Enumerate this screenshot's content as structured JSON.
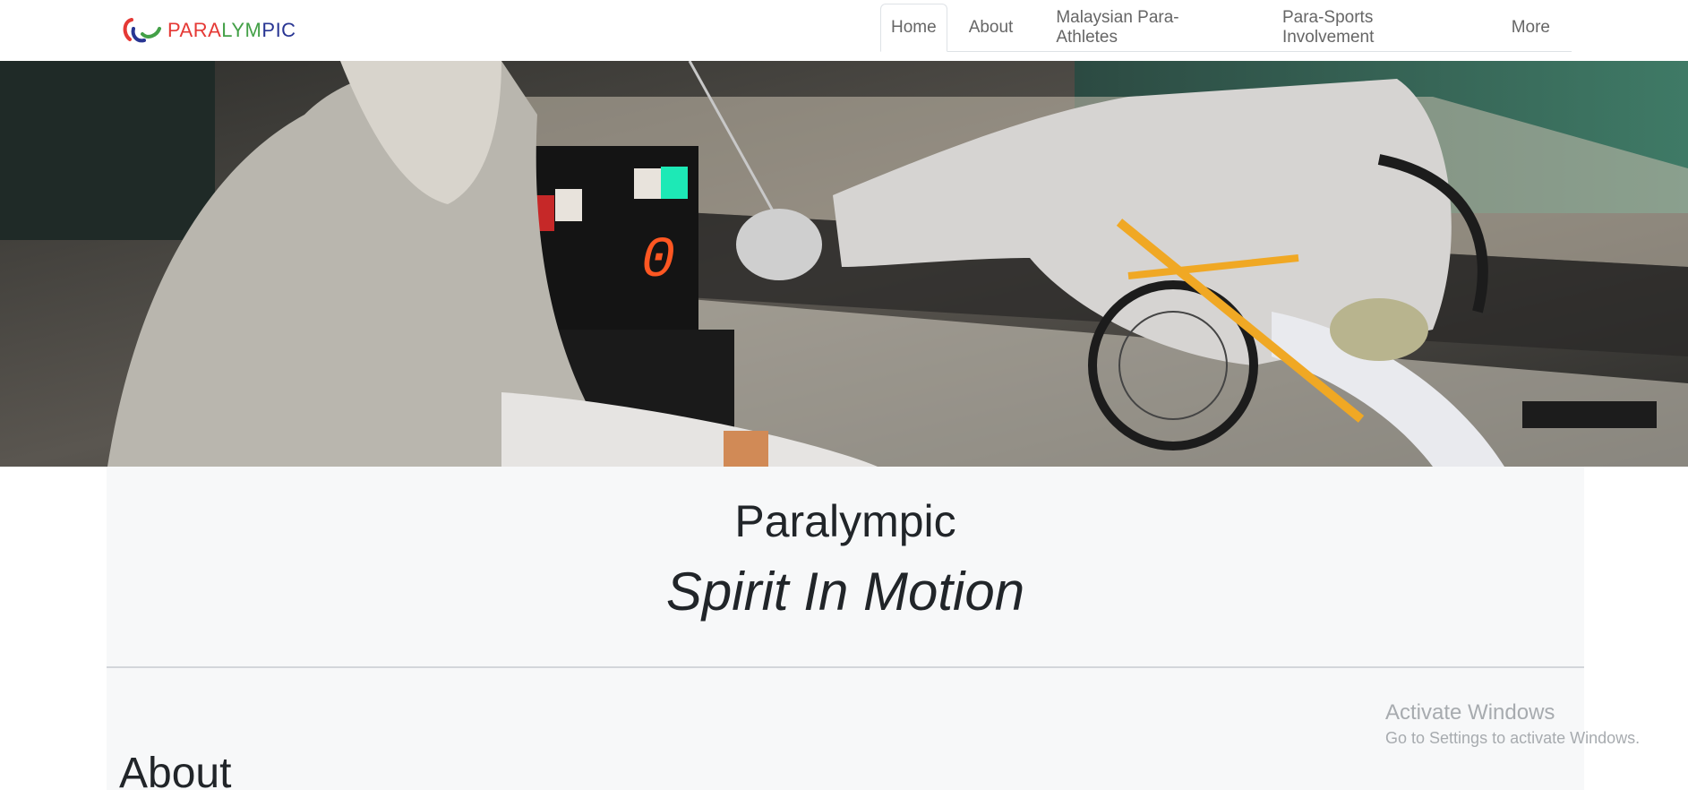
{
  "brand": {
    "parts": [
      "PARA",
      "LYM",
      "PIC"
    ]
  },
  "nav": {
    "items": [
      {
        "label": "Home",
        "active": true
      },
      {
        "label": "About",
        "active": false
      },
      {
        "label": "Malaysian Para-Athletes",
        "active": false
      },
      {
        "label": "Para-Sports Involvement",
        "active": false
      },
      {
        "label": "More",
        "active": false
      }
    ]
  },
  "hero": {
    "scoreboard_digit": "0"
  },
  "header": {
    "title": "Paralympic",
    "subtitle": "Spirit In Motion"
  },
  "about": {
    "heading": "About"
  },
  "watermark": {
    "title": "Activate Windows",
    "subtitle": "Go to Settings to activate Windows."
  },
  "colors": {
    "brand_red": "#e53935",
    "brand_green": "#43a047",
    "brand_blue": "#283593"
  }
}
